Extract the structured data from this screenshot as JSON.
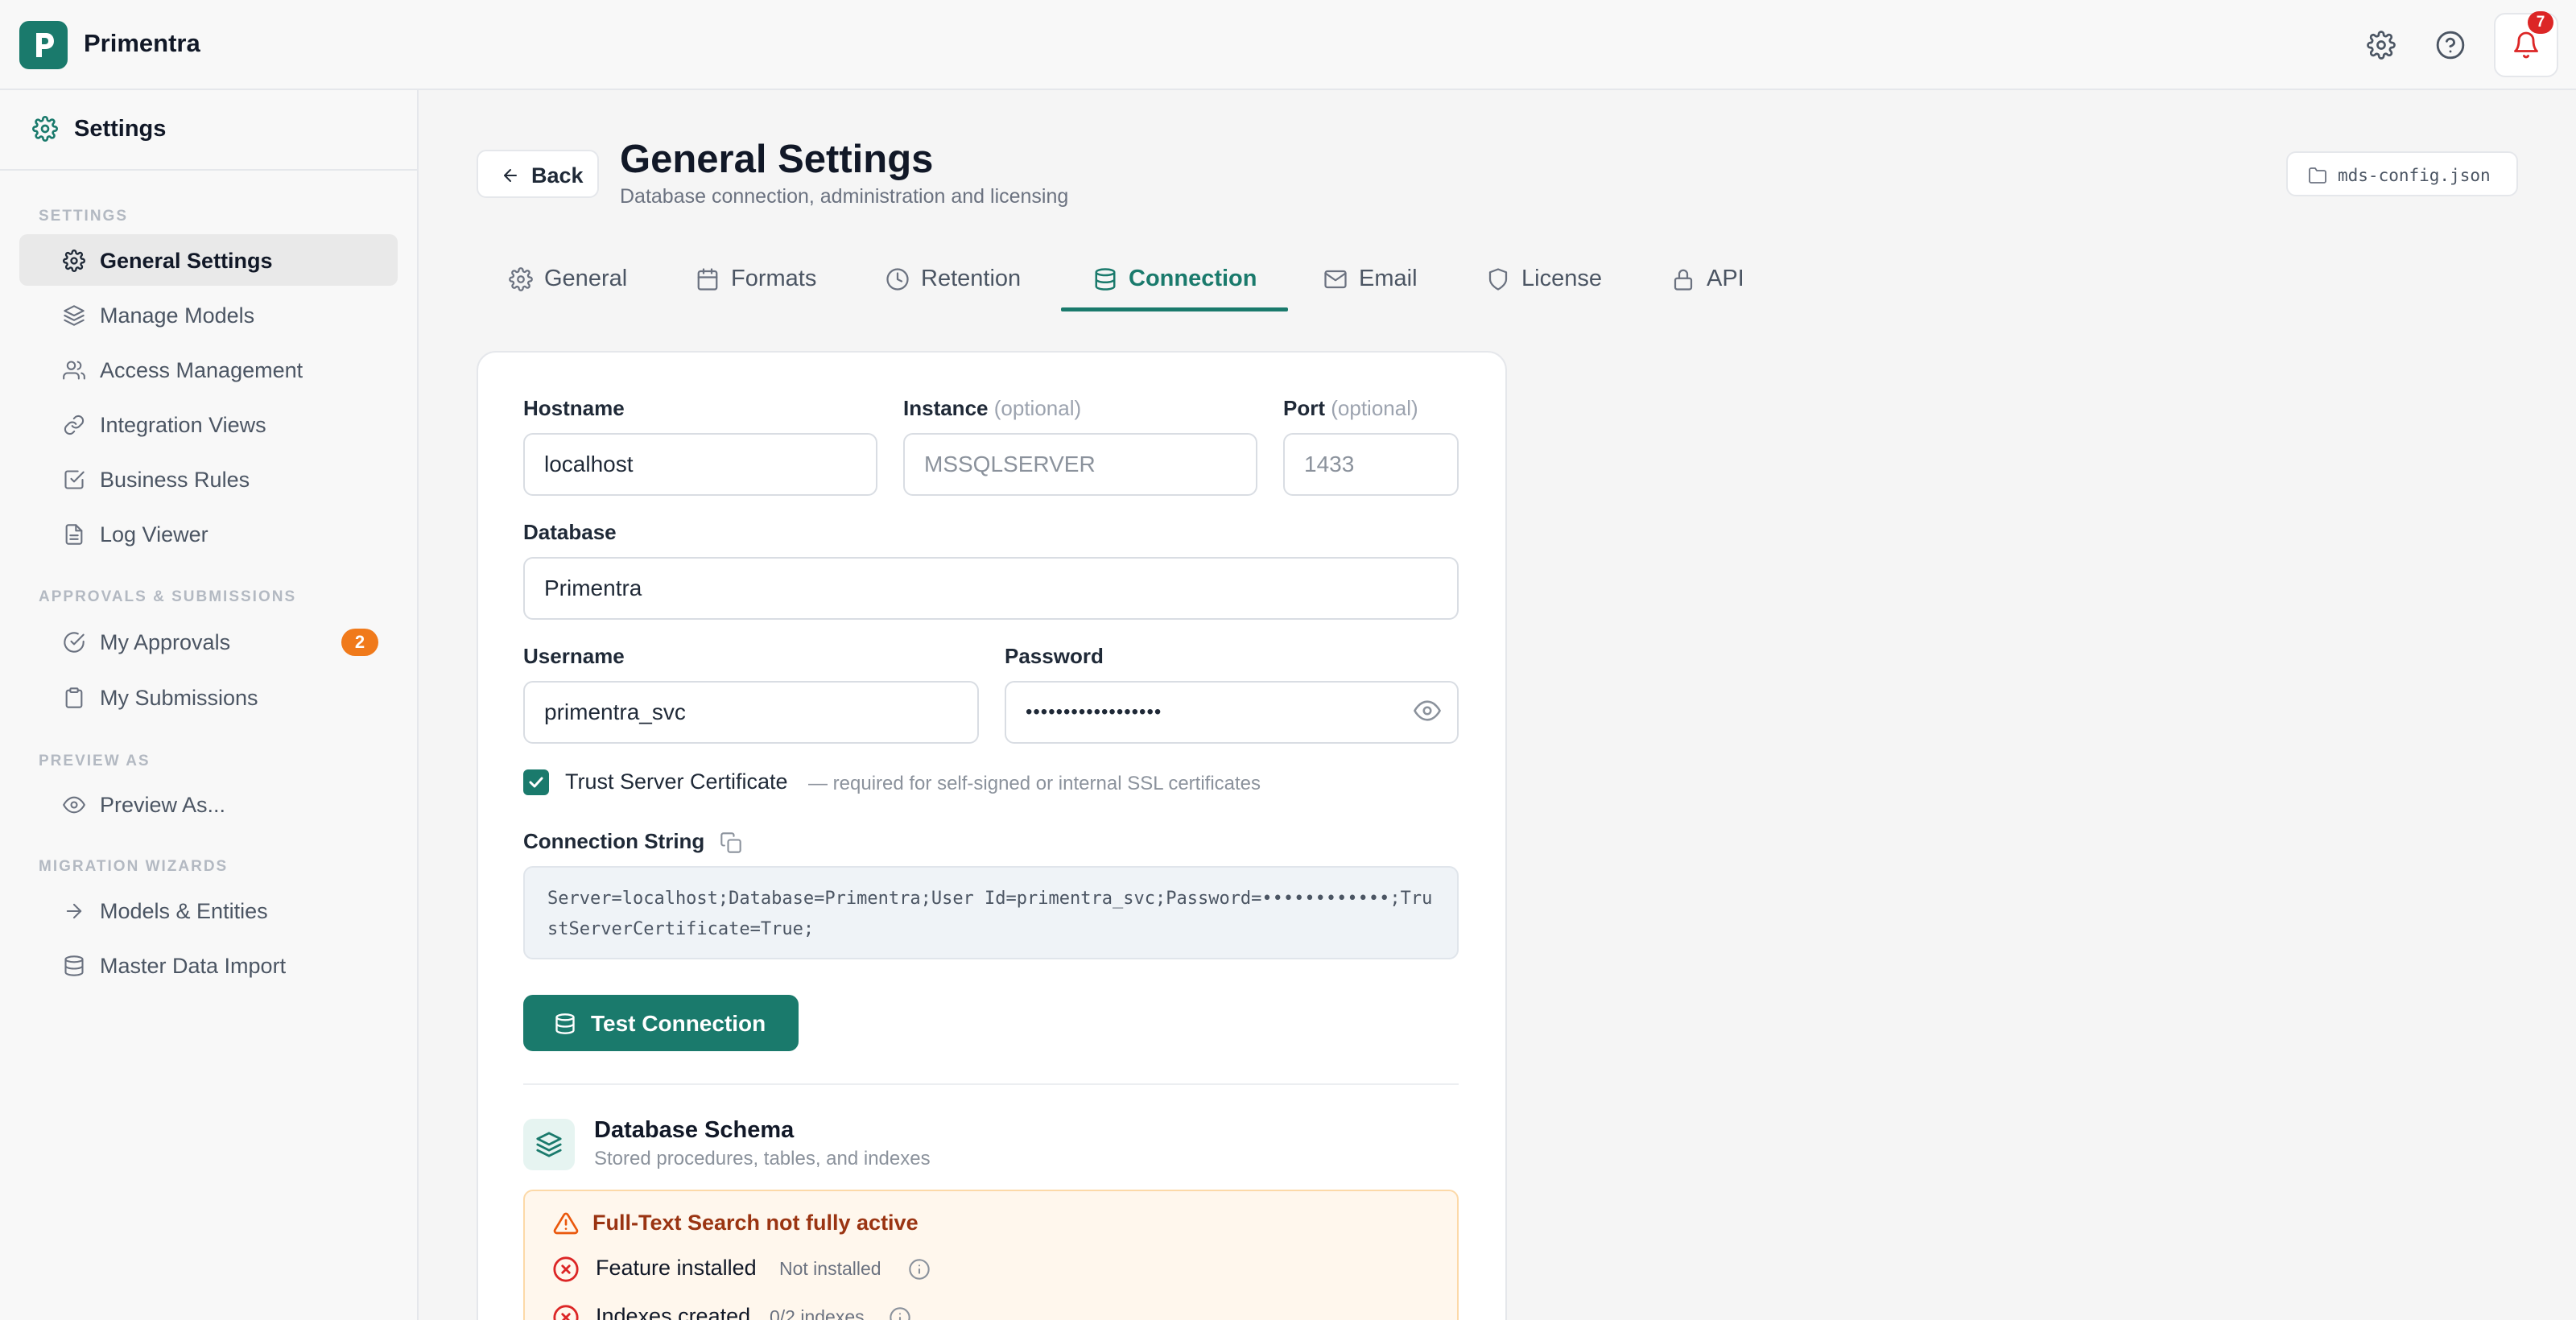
{
  "app": {
    "name": "Primentra"
  },
  "topbar": {
    "notification_count": "7"
  },
  "sidebar": {
    "header": "Settings",
    "sections": {
      "settings": "SETTINGS",
      "approvals": "APPROVALS & SUBMISSIONS",
      "preview": "PREVIEW AS",
      "migration": "MIGRATION WIZARDS"
    },
    "items": [
      {
        "label": "General Settings",
        "icon": "gear-icon"
      },
      {
        "label": "Manage Models",
        "icon": "layers-icon"
      },
      {
        "label": "Access Management",
        "icon": "users-icon"
      },
      {
        "label": "Integration Views",
        "icon": "link-icon"
      },
      {
        "label": "Business Rules",
        "icon": "check-square-icon"
      },
      {
        "label": "Log Viewer",
        "icon": "file-icon"
      },
      {
        "label": "My Approvals",
        "icon": "check-circle-icon",
        "badge": "2"
      },
      {
        "label": "My Submissions",
        "icon": "clipboard-icon"
      },
      {
        "label": "Preview As...",
        "icon": "eye-icon"
      },
      {
        "label": "Models & Entities",
        "icon": "arrow-right-icon"
      },
      {
        "label": "Master Data Import",
        "icon": "database-icon"
      }
    ]
  },
  "header": {
    "back_label": "Back",
    "title": "General Settings",
    "subtitle": "Database connection, administration and licensing",
    "config_file": "mds-config.json"
  },
  "tabs": [
    {
      "label": "General",
      "icon": "gear-icon"
    },
    {
      "label": "Formats",
      "icon": "calendar-icon"
    },
    {
      "label": "Retention",
      "icon": "clock-icon"
    },
    {
      "label": "Connection",
      "icon": "database-icon",
      "active": true
    },
    {
      "label": "Email",
      "icon": "mail-icon"
    },
    {
      "label": "License",
      "icon": "shield-icon"
    },
    {
      "label": "API",
      "icon": "lock-icon"
    }
  ],
  "form": {
    "hostname_label": "Hostname",
    "hostname_value": "localhost",
    "instance_label": "Instance",
    "instance_optional": "(optional)",
    "instance_placeholder": "MSSQLSERVER",
    "port_label": "Port",
    "port_optional": "(optional)",
    "port_placeholder": "1433",
    "database_label": "Database",
    "database_value": "Primentra",
    "username_label": "Username",
    "username_value": "primentra_svc",
    "password_label": "Password",
    "password_value": "••••••••••••••••••",
    "trust_label": "Trust Server Certificate",
    "trust_hint": "— required for self-signed or internal SSL certificates",
    "connstring_label": "Connection String",
    "connstring_value": "Server=localhost;Database=Primentra;User Id=primentra_svc;Password=••••••••••••;TrustServerCertificate=True;",
    "test_button": "Test Connection"
  },
  "schema": {
    "title": "Database Schema",
    "subtitle": "Stored procedures, tables, and indexes",
    "warning_title": "Full-Text Search not fully active",
    "checks": [
      {
        "label": "Feature installed",
        "value": "Not installed"
      },
      {
        "label": "Indexes created",
        "value": "0/2 indexes"
      }
    ]
  },
  "colors": {
    "accent": "#1a7a6c",
    "badge": "#f07a1b",
    "alert": "#dc2626",
    "warning": "#9a3412"
  }
}
